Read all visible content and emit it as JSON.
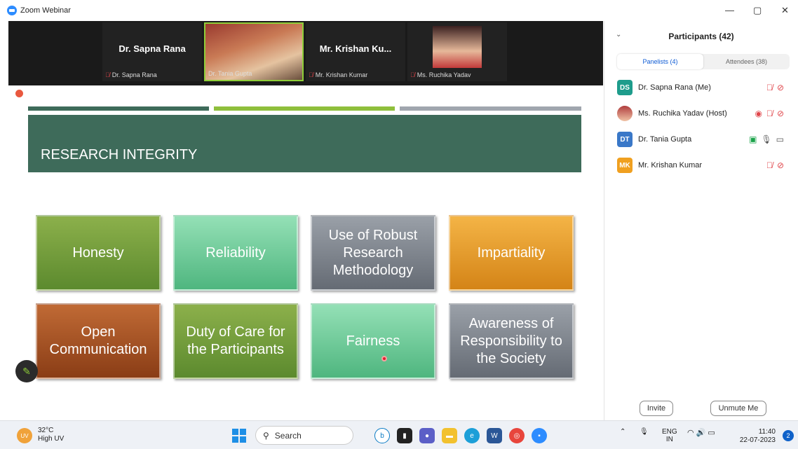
{
  "window": {
    "title": "Zoom Webinar",
    "minimize": "—",
    "restore": "▢",
    "close": "✕"
  },
  "video_strip": {
    "tiles": [
      {
        "big_name": "Dr. Sapna Rana",
        "label": "Dr. Sapna Rana",
        "muted": true
      },
      {
        "big_name": "",
        "label": "Dr. Tania Gupta",
        "muted": false,
        "active": true
      },
      {
        "big_name": "Mr. Krishan Ku...",
        "label": "Mr. Krishan Kumar",
        "muted": true
      },
      {
        "big_name": "",
        "label": "Ms. Ruchika Yadav",
        "muted": true
      }
    ]
  },
  "slide": {
    "title": "RESEARCH INTEGRITY",
    "boxes": [
      "Honesty",
      "Reliability",
      "Use of Robust Research Methodology",
      "Impartiality",
      "Open Communication",
      "Duty of Care for the Participants",
      "Fairness",
      "Awareness of Responsibility to the Society"
    ]
  },
  "participants_panel": {
    "title": "Participants (42)",
    "tabs": {
      "panelists": "Panelists (4)",
      "attendees": "Attendees (38)"
    },
    "rows": [
      {
        "initials": "DS",
        "name": "Dr. Sapna Rana (Me)",
        "color": "#1e9c8c"
      },
      {
        "initials": "",
        "name": "Ms. Ruchika Yadav (Host)",
        "color": "#b03d3d"
      },
      {
        "initials": "DT",
        "name": "Dr. Tania Gupta",
        "color": "#3a78c8"
      },
      {
        "initials": "MK",
        "name": "Mr. Krishan Kumar",
        "color": "#f0a020"
      }
    ],
    "invite_button": "Invite",
    "unmute_button": "Unmute Me"
  },
  "taskbar": {
    "weather_temp": "32°C",
    "weather_desc": "High UV",
    "weather_badge": "UV",
    "search_placeholder": "Search",
    "tray_lang_1": "ENG",
    "tray_lang_2": "IN",
    "time": "11:40",
    "date": "22-07-2023",
    "notifications": "2"
  }
}
